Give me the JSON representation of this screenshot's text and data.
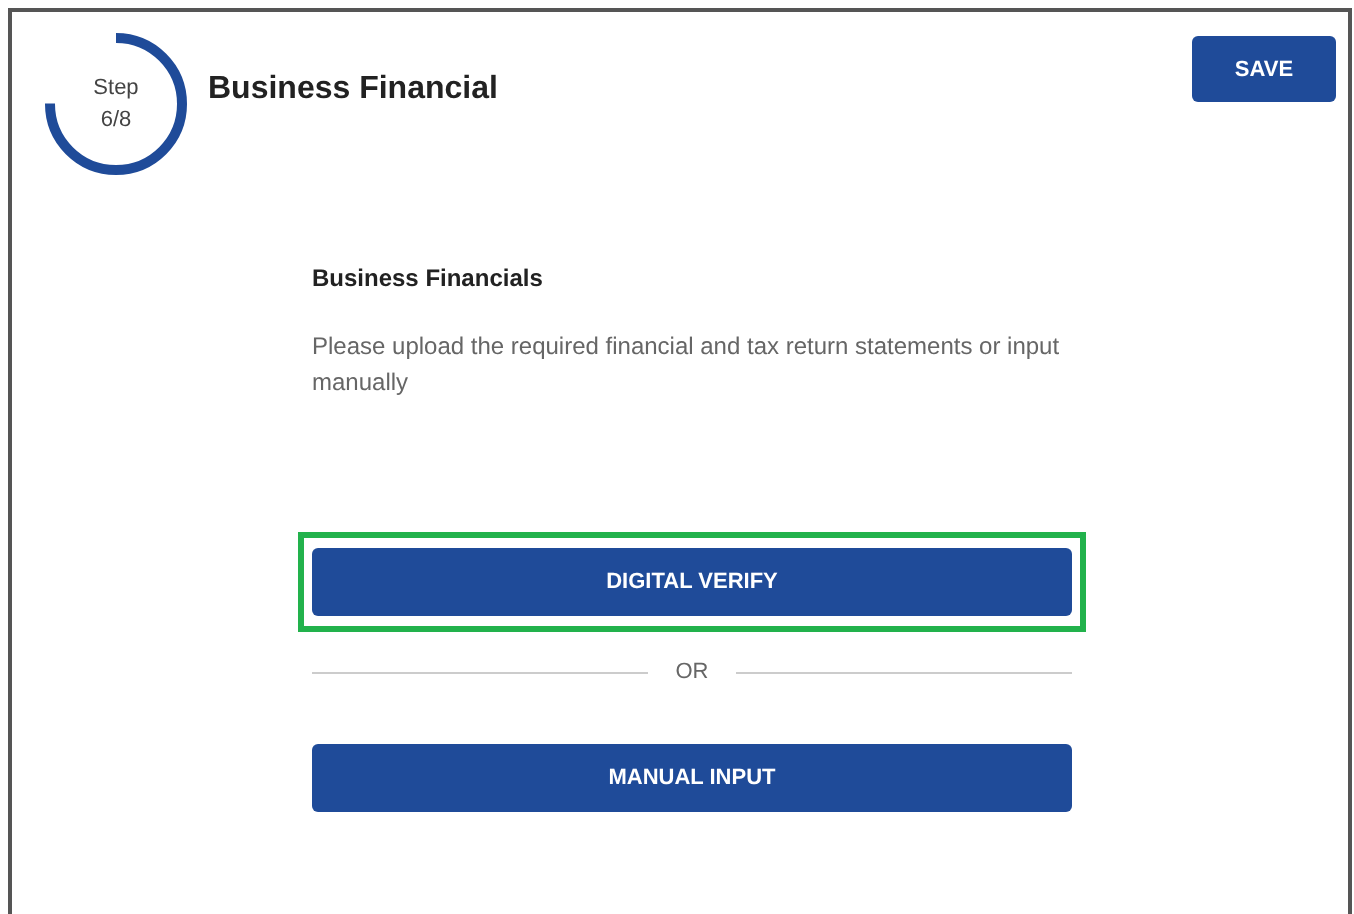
{
  "step": {
    "label": "Step",
    "count": "6/8",
    "level": 0.75
  },
  "title": "Business Financial",
  "save_button": "SAVE",
  "section": {
    "heading": "Business Financials",
    "description": "Please upload the required financial and tax return statements or input manually"
  },
  "options": [
    {
      "kind": "button",
      "label": "DIGITAL VERIFY",
      "highlighted": true
    },
    {
      "kind": "divider",
      "label": "OR"
    },
    {
      "kind": "button",
      "label": "MANUAL INPUT",
      "highlighted": false
    }
  ]
}
